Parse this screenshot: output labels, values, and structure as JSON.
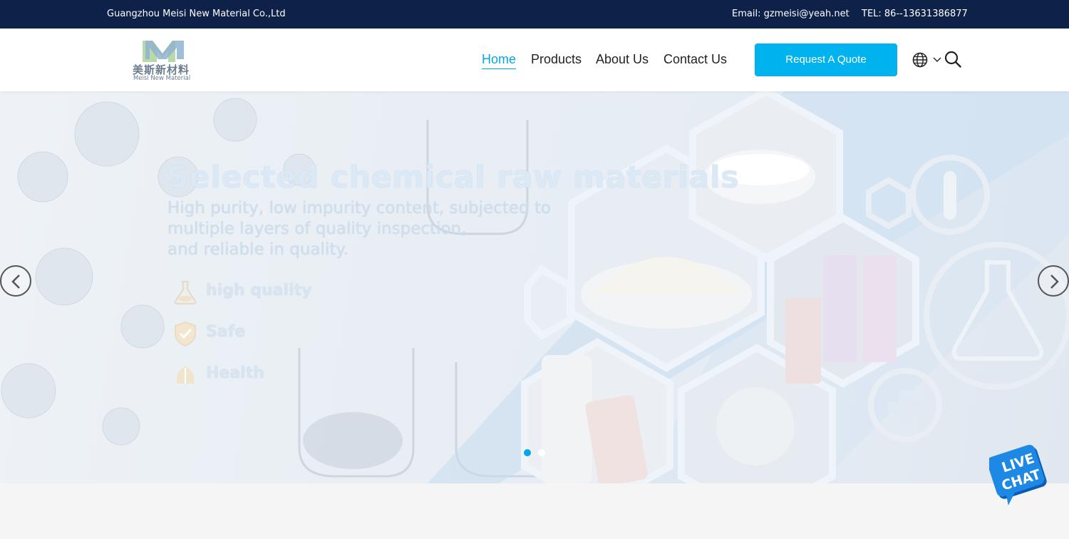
{
  "topbar": {
    "company": "Guangzhou Meisi New Material Co.,Ltd",
    "email": "Email: gzmeisi@yeah.net",
    "tel": "TEL: 86--13631386877"
  },
  "logo": {
    "cn": "美斯新材料",
    "en": "Meisi New Material"
  },
  "nav": {
    "home": "Home",
    "products": "Products",
    "about": "About Us",
    "contact": "Contact Us"
  },
  "quote_button": "Request A Quote",
  "icons": {
    "language": "globe-icon",
    "dropdown": "chevron-down-icon",
    "search": "search-icon",
    "prev": "chevron-left-icon",
    "next": "chevron-right-icon",
    "livechat": "live-chat-icon"
  },
  "hero": {
    "title": "Selected chemical raw materials",
    "subtitle_line1": "High purity, low impurity content, subjected to",
    "subtitle_line2": "multiple layers of quality inspection,",
    "subtitle_line3": "and reliable in quality.",
    "features": [
      "high quality",
      "Safe",
      "Health"
    ],
    "slides_total": 2,
    "active_slide": 1
  },
  "livechat": {
    "line1": "LIVE",
    "line2": "CHAT"
  },
  "colors": {
    "topbar": "#0e2148",
    "accent": "#00b2ee",
    "nav_active": "#00a8e8"
  }
}
